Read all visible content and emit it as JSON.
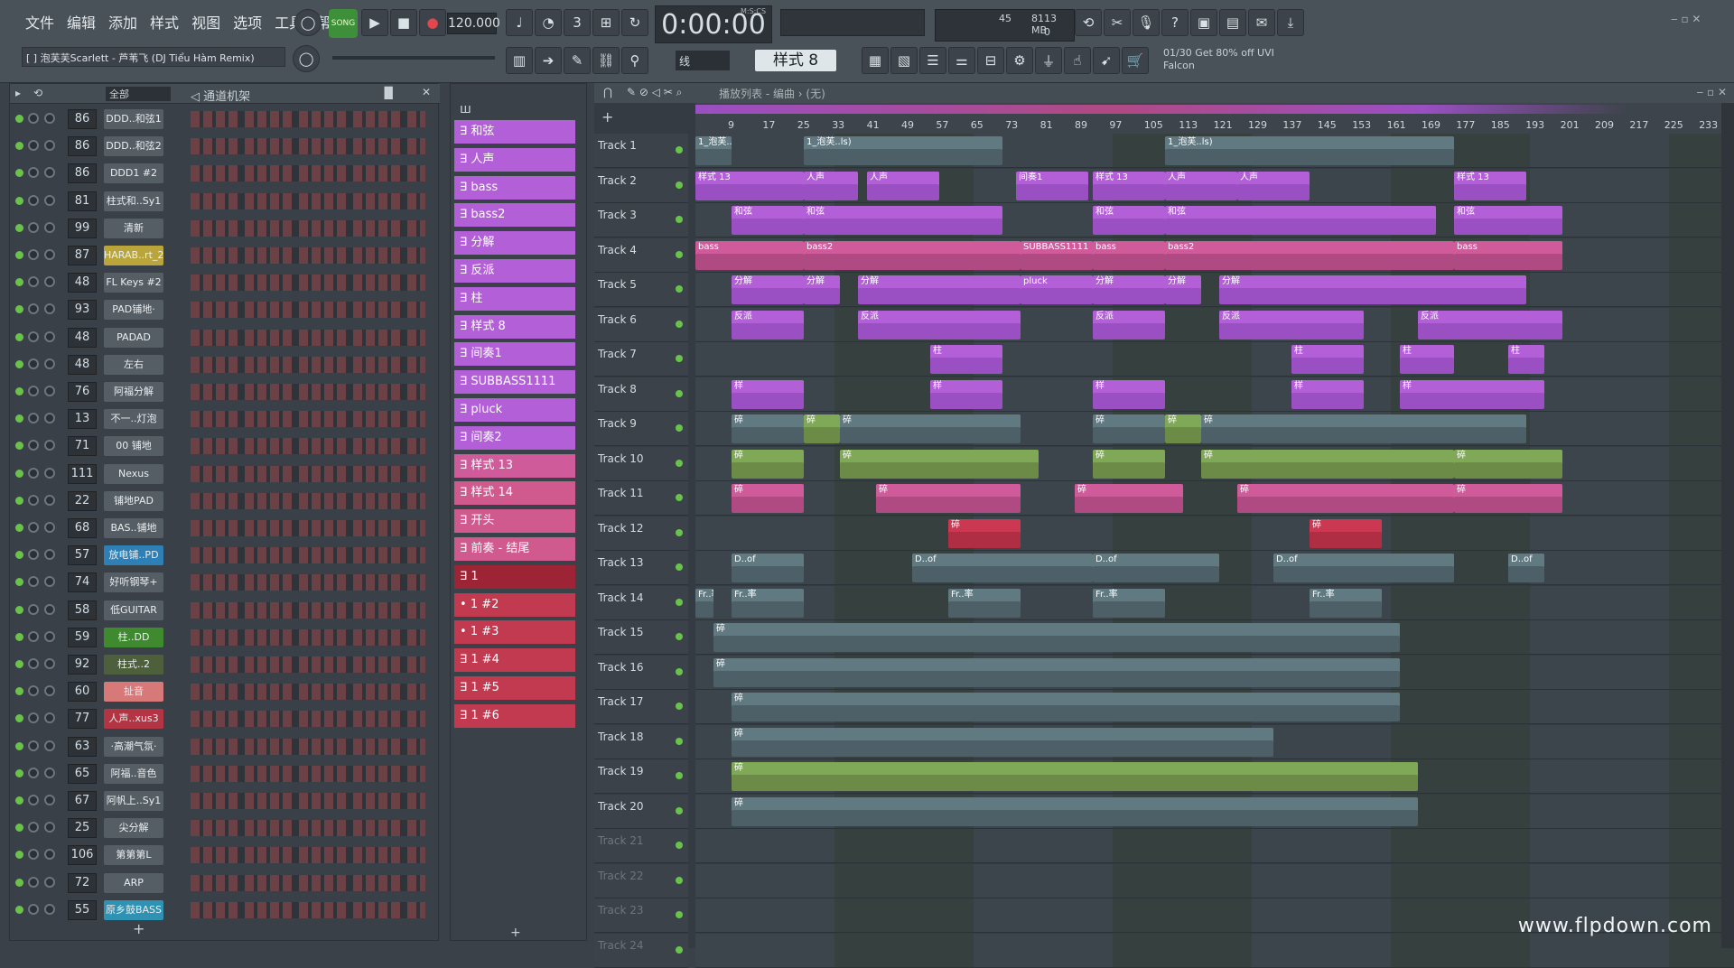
{
  "menu": [
    "文件",
    "编辑",
    "添加",
    "样式",
    "视图",
    "选项",
    "工具",
    "帮助"
  ],
  "transport": {
    "mode": "SONG",
    "tempo": "120.000",
    "time": "0:00:00",
    "time_label": "M:S:CS",
    "pattern": "样式 8",
    "snap": "线"
  },
  "song_info": "[ ] 泡芙芙Scarlett - 芦苇飞 (DJ Tiểu Hàm Remix)",
  "cpu": {
    "value": "45",
    "memory": "8113 MB",
    "poly": "0"
  },
  "promo": {
    "line1": "01/30  Get 80% off UVI",
    "line2": "Falcon"
  },
  "rack": {
    "filter": "全部",
    "title": "通道机架"
  },
  "channels": [
    {
      "num": "86",
      "name": "DDD..和弦1"
    },
    {
      "num": "86",
      "name": "DDD..和弦2"
    },
    {
      "num": "86",
      "name": "DDD1 #2"
    },
    {
      "num": "81",
      "name": "柱式和..Sy1"
    },
    {
      "num": "99",
      "name": "清新"
    },
    {
      "num": "87",
      "name": "HARAB..rt_2"
    },
    {
      "num": "48",
      "name": "FL Keys #2"
    },
    {
      "num": "93",
      "name": "PAD铺地·"
    },
    {
      "num": "48",
      "name": "PADAD"
    },
    {
      "num": "48",
      "name": "左右"
    },
    {
      "num": "76",
      "name": "阿福分解"
    },
    {
      "num": "13",
      "name": "不一..灯泡"
    },
    {
      "num": "71",
      "name": "00 铺地"
    },
    {
      "num": "111",
      "name": "Nexus"
    },
    {
      "num": "22",
      "name": "铺地PAD"
    },
    {
      "num": "68",
      "name": "BAS..铺地"
    },
    {
      "num": "57",
      "name": "放电铺..PD"
    },
    {
      "num": "74",
      "name": "好听钢琴+"
    },
    {
      "num": "58",
      "name": "低GUITAR"
    },
    {
      "num": "59",
      "name": "柱..DD"
    },
    {
      "num": "92",
      "name": "柱式..2"
    },
    {
      "num": "60",
      "name": "扯音"
    },
    {
      "num": "77",
      "name": "人声..xus3"
    },
    {
      "num": "63",
      "name": "·高潮气氛·"
    },
    {
      "num": "65",
      "name": "阿福..音色"
    },
    {
      "num": "67",
      "name": "阿帆上..Sy1"
    },
    {
      "num": "25",
      "name": "尖分解"
    },
    {
      "num": "106",
      "name": "第第第L"
    },
    {
      "num": "72",
      "name": "ARP"
    },
    {
      "num": "55",
      "name": "原乡鼓BASS"
    }
  ],
  "patterns": [
    "和弦",
    "人声",
    "bass",
    "bass2",
    "分解",
    "反派",
    "柱",
    "样式 8",
    "间奏1",
    "SUBBASS1111",
    "pluck",
    "间奏2",
    "样式 13",
    "样式 14",
    "开头",
    "前奏 - 结尾",
    "1",
    "1 #2",
    "1 #3",
    "1 #4",
    "1 #5",
    "1 #6"
  ],
  "playlist": {
    "title": "播放列表 - 编曲 › (无)",
    "ruler": [
      "9",
      "17",
      "25",
      "33",
      "41",
      "49",
      "57",
      "65",
      "73",
      "81",
      "89",
      "97",
      "105",
      "113",
      "121",
      "129",
      "137",
      "145",
      "153",
      "161",
      "169",
      "177",
      "185",
      "193",
      "201",
      "209",
      "217",
      "225",
      "233"
    ]
  },
  "tracks": [
    "Track 1",
    "Track 2",
    "Track 3",
    "Track 4",
    "Track 5",
    "Track 6",
    "Track 7",
    "Track 8",
    "Track 9",
    "Track 10",
    "Track 11",
    "Track 12",
    "Track 13",
    "Track 14",
    "Track 15",
    "Track 16",
    "Track 17",
    "Track 18",
    "Track 19",
    "Track 20",
    "Track 21",
    "Track 22",
    "Track 23",
    "Track 24"
  ],
  "clip_labels": {
    "t1": "1_泡芙..ls)",
    "t2a": "人声",
    "t2b": "样式 13",
    "t2c": "间奏1",
    "t3": "和弦",
    "t4a": "bass",
    "t4b": "bass2",
    "t4c": "SUBBASS1111",
    "t5a": "分解",
    "t5b": "pluck",
    "t6": "反派",
    "t7": "柱",
    "t8": "样",
    "t9": "碎",
    "t13": "D..of",
    "t14": "Fr..率"
  },
  "watermark": "www.flpdown.com",
  "colors": {
    "clip_purple": "#9a4fc2",
    "clip_pink": "#b04a83",
    "clip_green": "#6b8b46",
    "clip_red": "#b02e43",
    "led": "#69c34a"
  }
}
